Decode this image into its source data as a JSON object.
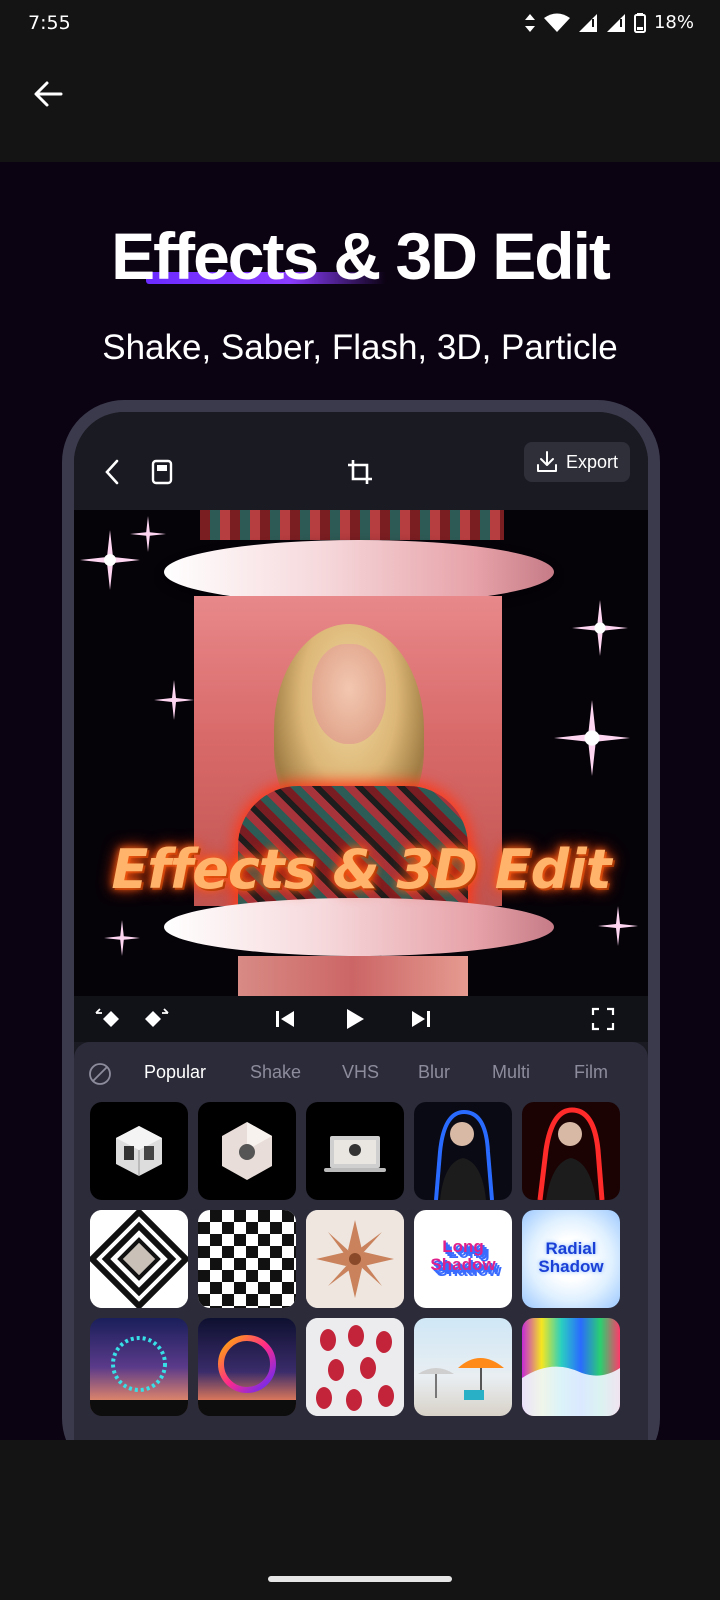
{
  "status_bar": {
    "time": "7:55",
    "battery_percent": "18%",
    "icons": [
      "data-arrows-icon",
      "wifi-icon",
      "signal-icon",
      "signal-icon",
      "battery-icon"
    ]
  },
  "app_bar": {
    "back_icon": "arrow-left-icon"
  },
  "promo": {
    "headline": "Effects & 3D Edit",
    "subhead": "Shake, Saber, Flash, 3D, Particle",
    "accent_color": "#7b35ff"
  },
  "editor": {
    "toolbar": {
      "back_icon": "chevron-left-icon",
      "note_icon": "notebook-icon",
      "crop_icon": "crop-icon",
      "export_label": "Export",
      "export_icon": "download-icon"
    },
    "preview": {
      "overlay_text": "Effects & 3D Edit"
    },
    "transport": [
      "keyframe-prev-icon",
      "keyframe-next-icon",
      "skip-back-icon",
      "play-icon",
      "skip-forward-icon",
      "fullscreen-icon"
    ],
    "effects": {
      "none_icon": "no-effect-icon",
      "tabs": [
        "Popular",
        "Shake",
        "VHS",
        "Blur",
        "Multi",
        "Film"
      ],
      "active_tab": "Popular",
      "tiles": [
        {
          "name": "cube-3d"
        },
        {
          "name": "polyhedron-3d"
        },
        {
          "name": "laptop-screen"
        },
        {
          "name": "blue-neon-outline"
        },
        {
          "name": "red-glow-outline"
        },
        {
          "name": "diamond-mirror"
        },
        {
          "name": "checkerboard"
        },
        {
          "name": "kaleidoscope"
        },
        {
          "name": "long-shadow",
          "label": "Long Shadow"
        },
        {
          "name": "radial-shadow",
          "label": "Radial Shadow"
        },
        {
          "name": "particle-ring-cyan"
        },
        {
          "name": "particle-ring-gradient"
        },
        {
          "name": "tulips-multi"
        },
        {
          "name": "beach-umbrellas"
        },
        {
          "name": "color-bars-glitch"
        }
      ]
    }
  }
}
